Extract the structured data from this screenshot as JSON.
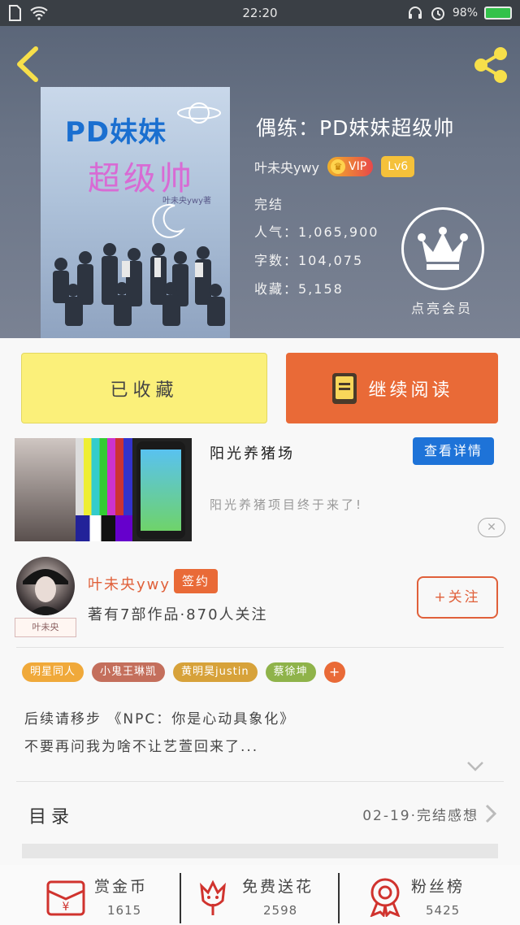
{
  "status_bar": {
    "time": "22:20",
    "battery": "98%"
  },
  "book": {
    "title": "偶练：PD妹妹超级帅",
    "author": "叶未央ywy",
    "vip_label": "VIP",
    "level_label": "Lv6",
    "status": "完结",
    "popularity": "人气：1,065,900",
    "word_count": "字数：104,075",
    "favorites": "收藏：5,158",
    "member_label": "点亮会员",
    "cover": {
      "title_line1": "PD妹妹",
      "title_line2": "超级帅",
      "byline": "叶未央ywy著"
    }
  },
  "actions": {
    "collected_label": "已收藏",
    "continue_label": "继续阅读"
  },
  "ad": {
    "title": "阳光养猪场",
    "detail_button": "查看详情",
    "description": "阳光养猪项目终于来了!",
    "close_label": "✕"
  },
  "author": {
    "name": "叶未央ywy",
    "sign_badge": "签约",
    "avatar_tag": "叶未央",
    "stats": "著有7部作品·870人关注",
    "follow_label": "+关注"
  },
  "tags": [
    {
      "label": "明星同人",
      "color": "#f0a93a"
    },
    {
      "label": "小鬼王琳凯",
      "color": "#c46f5c"
    },
    {
      "label": "黄明昊justin",
      "color": "#d7a23a"
    },
    {
      "label": "蔡徐坤",
      "color": "#8fb34a"
    }
  ],
  "tag_plus": "+",
  "intro": {
    "line1": "后续请移步 《NPC：你是心动具象化》",
    "line2": "不要再问我为啥不让艺萱回来了..."
  },
  "catalog": {
    "label": "目录",
    "latest": "02-19·完结感想"
  },
  "bottom_bar": {
    "reward_label": "赏金币",
    "reward_count": "1615",
    "flower_label": "免费送花",
    "flower_count": "2598",
    "fans_label": "粉丝榜",
    "fans_count": "5425"
  },
  "colors": {
    "accent": "#e96a37",
    "collect_bg": "#fbf07a",
    "ad_button": "#1e73d8"
  }
}
